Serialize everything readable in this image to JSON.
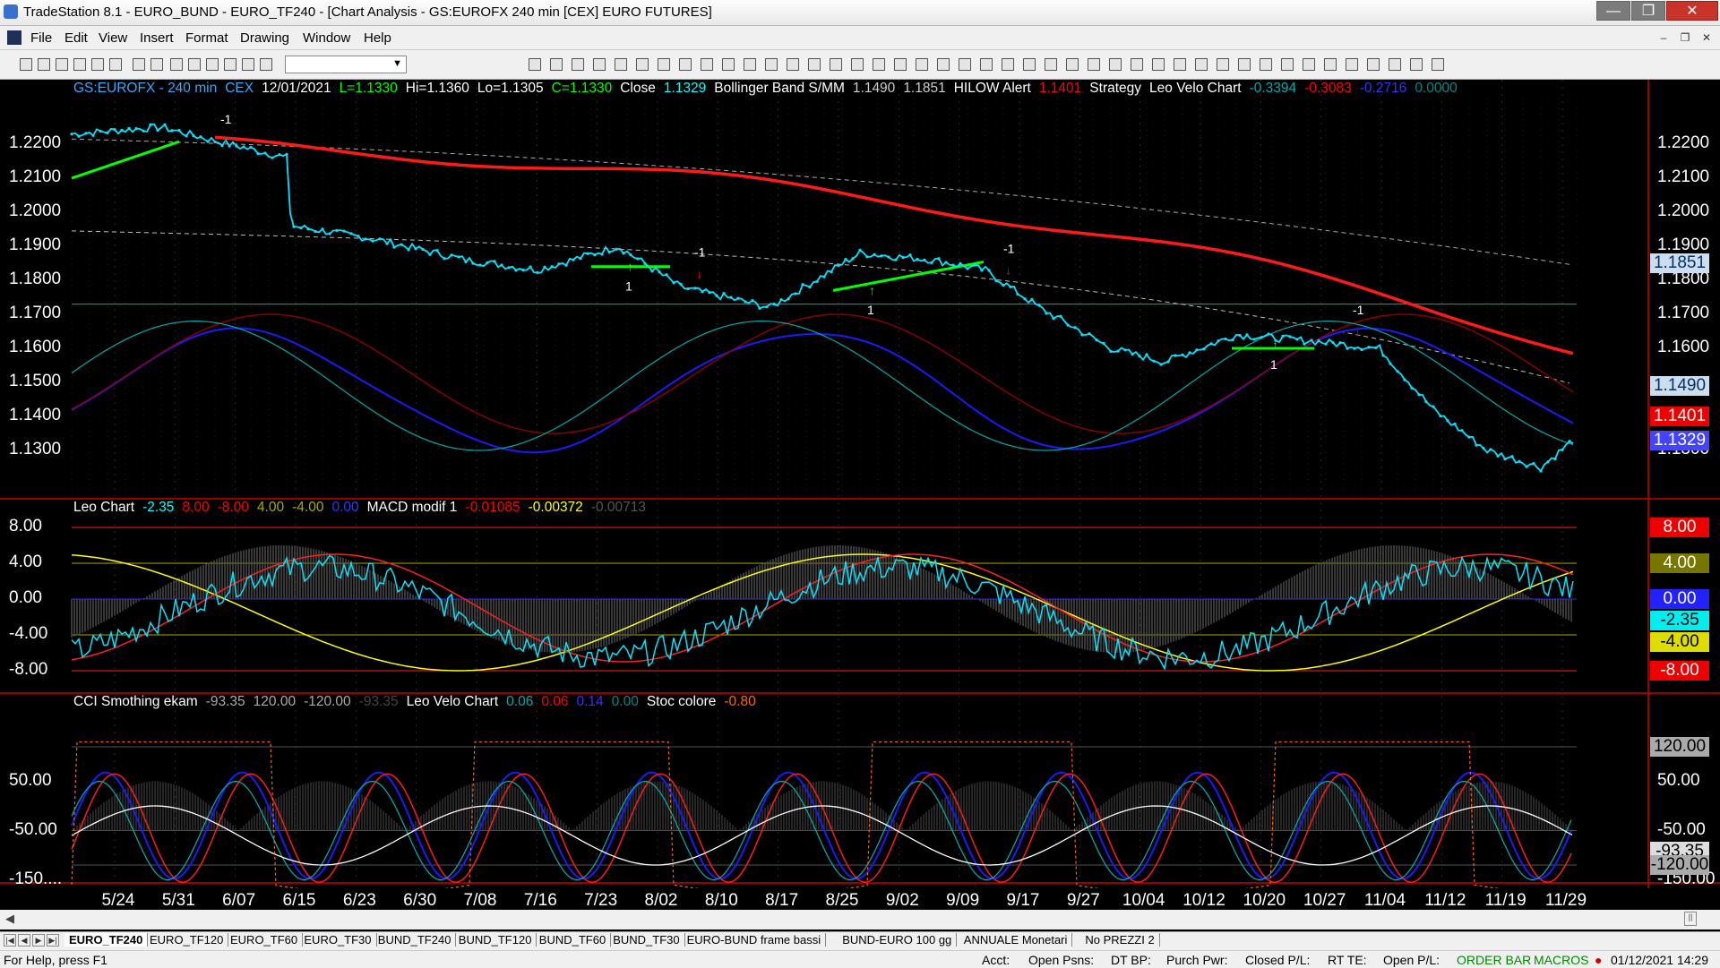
{
  "window": {
    "title": "TradeStation 8.1 - EURO_BUND - EURO_TF240 - [Chart Analysis - GS:EUROFX  240 min  [CEX] EURO FUTURES]",
    "min": "—",
    "max": "❐",
    "close": "✕"
  },
  "menu": [
    "File",
    "Edit",
    "View",
    "Insert",
    "Format",
    "Drawing",
    "Window",
    "Help"
  ],
  "mdi": [
    "–",
    "❐",
    "✕"
  ],
  "chart": {
    "legend1": {
      "symbol": "GS:EUROFX - 240 min",
      "exch": "CEX",
      "date": "12/01/2021",
      "low_last": "L=1.1330",
      "hi": "Hi=1.1360",
      "lo": "Lo=1.1305",
      "close_val": "C=1.1330",
      "close_label": "Close",
      "close_num": "1.1329",
      "bb_label": "Bollinger Band S/MM",
      "bb1": "1.1490",
      "bb2": "1.1851",
      "hilow_label": "HILOW Alert",
      "hilow_val": "1.1401",
      "strategy": "Strategy",
      "leo_label": "Leo Velo Chart",
      "leo_v1": "-0.3394",
      "leo_v2": "-0.3083",
      "leo_v3": "-0.2716",
      "leo_v4": "0.0000"
    },
    "legend2": {
      "leo_label": "Leo Chart",
      "v1": "-2.35",
      "v2": "8.00",
      "v3": "-8.00",
      "v4": "4.00",
      "v5": "-4.00",
      "v6": "0.00",
      "macd_label": "MACD modif 1",
      "m1": "-0.01085",
      "m2": "-0.00372",
      "m3": "-0.00713"
    },
    "legend3": {
      "cci_label": "CCI Smothing ekam",
      "c1": "-93.35",
      "c2": "120.00",
      "c3": "-120.00",
      "c4": "-93.35",
      "leo_label": "Leo Velo Chart",
      "l1": "0.06",
      "l2": "0.06",
      "l3": "0.14",
      "l4": "0.00",
      "stoc_label": "Stoc colore",
      "s1": "-0.80"
    },
    "price_ticks_left": [
      "1.2200",
      "1.2100",
      "1.2000",
      "1.1900",
      "1.1800",
      "1.1700",
      "1.1600",
      "1.1500",
      "1.1400",
      "1.1300"
    ],
    "price_ticks_right": [
      "1.2200",
      "1.2100",
      "1.2000",
      "1.1900",
      "1.1800",
      "1.1700",
      "1.1600",
      "1.1300"
    ],
    "price_badges": [
      "1.1851",
      "1.1490",
      "1.1401",
      "1.1329"
    ],
    "macd_ticks_left": [
      "8.00",
      "4.00",
      "0.00",
      "-4.00",
      "-8.00"
    ],
    "macd_badges": [
      "8.00",
      "4.00",
      "0.00",
      "-2.35",
      "-4.00",
      "-8.00"
    ],
    "cci_ticks_left": [
      "50.00",
      "-50.00",
      "-150...."
    ],
    "cci_ticks_right": [
      "50.00",
      "-50.00",
      "-150.00"
    ],
    "cci_badges": [
      "120.00",
      "-93.35",
      "-120.00"
    ],
    "x_labels": [
      "5/24",
      "5/31",
      "6/07",
      "6/15",
      "6/23",
      "6/30",
      "7/08",
      "7/16",
      "7/23",
      "8/02",
      "8/10",
      "8/17",
      "8/25",
      "9/02",
      "9/09",
      "9/17",
      "9/27",
      "10/04",
      "10/12",
      "10/20",
      "10/27",
      "11/04",
      "11/12",
      "11/19",
      "11/29"
    ],
    "signals": [
      "-1",
      "1",
      "-1",
      "1",
      "-1",
      "1",
      "-1"
    ],
    "colors": {
      "price": "#00e5ff",
      "ma_red": "#ff0000",
      "ma_green": "#00ff00",
      "band_blue": "#1a1aff",
      "band_teal": "#0aa",
      "yellow": "#ffff00",
      "grid": "#333"
    }
  },
  "tabs": [
    "EURO_TF240",
    "EURO_TF120",
    "EURO_TF60",
    "EURO_TF30",
    "BUND_TF240",
    "BUND_TF120",
    "BUND_TF60",
    "BUND_TF30",
    "EURO-BUND frame bassi",
    "BUND-EURO 100 gg",
    "ANNUALE Monetari",
    "No PREZZI 2"
  ],
  "status": {
    "help": "For Help, press F1",
    "acct": "Acct:",
    "open_psns": "Open Psns:",
    "dt_bp": "DT BP:",
    "purch": "Purch Pwr:",
    "closed": "Closed P/L:",
    "rt_te": "RT TE:",
    "open_pl": "Open P/L:",
    "order_bar": "ORDER BAR",
    "macros": "MACROS",
    "datetime": "01/12/2021 14:29"
  }
}
